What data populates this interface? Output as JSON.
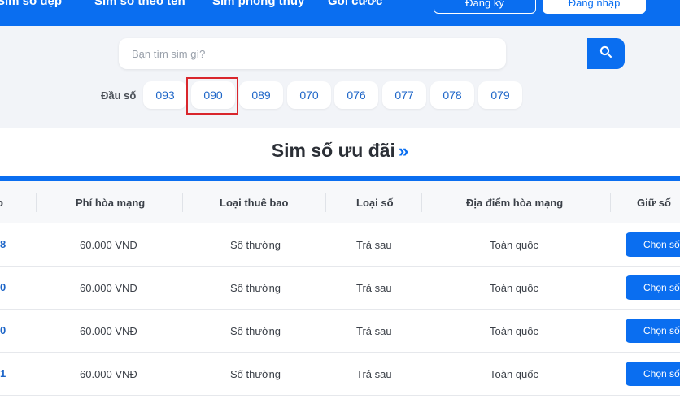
{
  "nav": {
    "items": [
      "Sim số đẹp",
      "Sim số theo tên",
      "Sim phong thủy",
      "Gói cước"
    ],
    "register_label": "Đăng ký",
    "login_label": "Đăng nhập"
  },
  "search": {
    "placeholder": "Bạn tìm sim gì?",
    "icon": "search-icon"
  },
  "prefix": {
    "label": "Đầu số",
    "options": [
      "093",
      "090",
      "089",
      "070",
      "076",
      "077",
      "078",
      "079"
    ],
    "highlighted": "090"
  },
  "section": {
    "title": "Sim số ưu đãi",
    "chevron": "»"
  },
  "table": {
    "headers": [
      "Phí hòa mạng",
      "Loại thuê bao",
      "Loại số",
      "Địa điểm hòa mạng",
      "Giữ số"
    ],
    "rows": [
      {
        "num": "8",
        "fee": "60.000 VNĐ",
        "sub_type": "Số thường",
        "num_type": "Trả sau",
        "location": "Toàn quốc",
        "action": "Chọn số"
      },
      {
        "num": "0",
        "fee": "60.000 VNĐ",
        "sub_type": "Số thường",
        "num_type": "Trả sau",
        "location": "Toàn quốc",
        "action": "Chọn số"
      },
      {
        "num": "0",
        "fee": "60.000 VNĐ",
        "sub_type": "Số thường",
        "num_type": "Trả sau",
        "location": "Toàn quốc",
        "action": "Chọn số"
      },
      {
        "num": "1",
        "fee": "60.000 VNĐ",
        "sub_type": "Số thường",
        "num_type": "Trả sau",
        "location": "Toàn quốc",
        "action": "Chọn số"
      }
    ]
  },
  "colors": {
    "primary": "#0a6ef0",
    "link": "#1e66c8",
    "highlight": "#d9262c"
  }
}
